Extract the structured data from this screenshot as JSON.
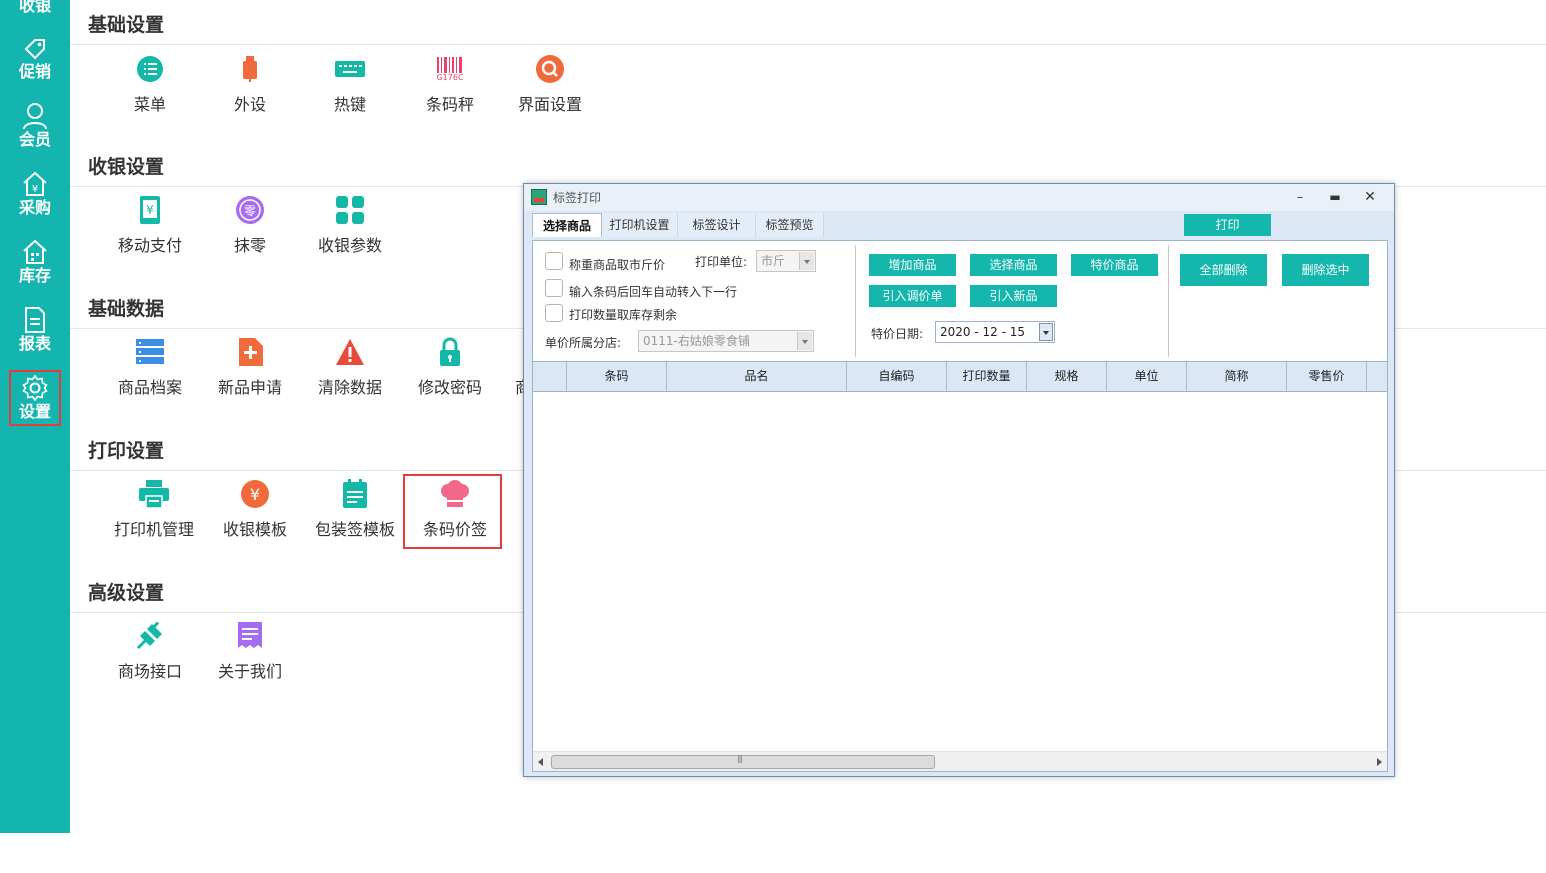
{
  "sidebar": {
    "items": [
      {
        "label": "收银",
        "icon": "cashier-icon"
      },
      {
        "label": "促销",
        "icon": "tag-icon"
      },
      {
        "label": "会员",
        "icon": "user-icon"
      },
      {
        "label": "采购",
        "icon": "purchase-icon"
      },
      {
        "label": "库存",
        "icon": "warehouse-icon"
      },
      {
        "label": "报表",
        "icon": "report-icon"
      },
      {
        "label": "设置",
        "icon": "gear-icon",
        "active": true
      }
    ]
  },
  "sections": {
    "basic": {
      "title": "基础设置",
      "items": [
        {
          "label": "菜单",
          "icon": "menu-list-icon",
          "color": "#14b8a6"
        },
        {
          "label": "外设",
          "icon": "usb-device-icon",
          "color": "#f06a3c"
        },
        {
          "label": "热键",
          "icon": "keyboard-icon",
          "color": "#14b8a6"
        },
        {
          "label": "条码秤",
          "icon": "barcode-scale-icon",
          "color": "#e8436b",
          "caption": "G176C"
        },
        {
          "label": "界面设置",
          "icon": "interface-search-icon",
          "color": "#f06a3c"
        }
      ]
    },
    "cashier": {
      "title": "收银设置",
      "items": [
        {
          "label": "移动支付",
          "icon": "mobile-pay-icon",
          "color": "#14b8a6"
        },
        {
          "label": "抹零",
          "icon": "round-off-icon",
          "color": "#a56bf0",
          "glyph": "零"
        },
        {
          "label": "收银参数",
          "icon": "grid-params-icon",
          "color": "#14b8a6"
        }
      ]
    },
    "data": {
      "title": "基础数据",
      "items": [
        {
          "label": "商品档案",
          "icon": "product-archive-icon",
          "color": "#3b8fe6"
        },
        {
          "label": "新品申请",
          "icon": "new-product-icon",
          "color": "#f06a3c"
        },
        {
          "label": "清除数据",
          "icon": "warning-icon",
          "color": "#e84a3c"
        },
        {
          "label": "修改密码",
          "icon": "lock-icon",
          "color": "#14b8a6"
        },
        {
          "label": "商",
          "icon": "",
          "color": ""
        }
      ]
    },
    "print": {
      "title": "打印设置",
      "items": [
        {
          "label": "打印机管理",
          "icon": "printer-icon",
          "color": "#14b8a6"
        },
        {
          "label": "收银模板",
          "icon": "yuan-coin-icon",
          "color": "#f06a3c"
        },
        {
          "label": "包装签模板",
          "icon": "package-label-icon",
          "color": "#14b8a6"
        },
        {
          "label": "条码价签",
          "icon": "chef-hat-icon",
          "color": "#f2688a"
        }
      ]
    },
    "advanced": {
      "title": "高级设置",
      "items": [
        {
          "label": "商场接口",
          "icon": "plug-icon",
          "color": "#14b8a6"
        },
        {
          "label": "关于我们",
          "icon": "about-doc-icon",
          "color": "#a56bf0"
        }
      ]
    }
  },
  "dialog": {
    "title": "标签打印",
    "tabs": [
      "选择商品",
      "打印机设置",
      "标签设计",
      "标签预览"
    ],
    "print_button": "打印",
    "options": {
      "weigh_price": "称重商品取市斤价",
      "enter_next": "输入条码后回车自动转入下一行",
      "qty_from_stock": "打印数量取库存剩余"
    },
    "unit_label": "打印单位:",
    "unit_value": "市斤",
    "store_label": "单价所属分店:",
    "store_value": "0111-右姑娘零食铺",
    "buttons": {
      "add_product": "增加商品",
      "select_product": "选择商品",
      "special_product": "特价商品",
      "import_adjust": "引入调价单",
      "import_new": "引入新品",
      "delete_all": "全部删除",
      "delete_selected": "删除选中"
    },
    "special_date_label": "特价日期:",
    "special_date": "2020 - 12 - 15",
    "columns": [
      "条码",
      "品名",
      "自编码",
      "打印数量",
      "规格",
      "单位",
      "简称",
      "零售价"
    ]
  }
}
